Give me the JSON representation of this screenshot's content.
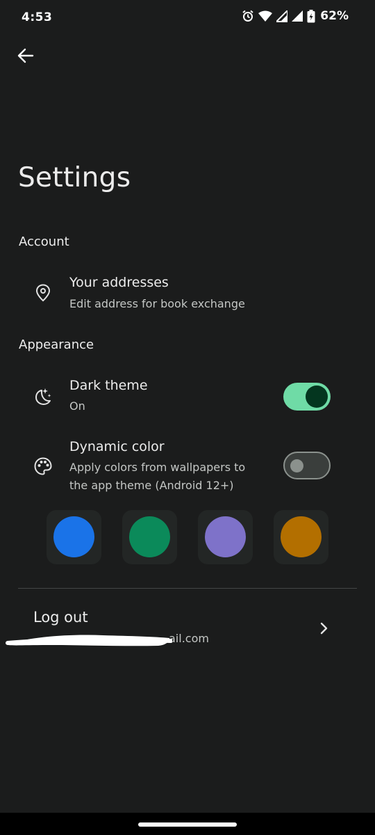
{
  "status_bar": {
    "time": "4:53",
    "battery": "62%",
    "icons": [
      "alarm-icon",
      "wifi-icon",
      "signal-icon",
      "signal-icon",
      "battery-charging-icon"
    ]
  },
  "header": {
    "back_icon": "arrow-back-icon",
    "title": "Settings"
  },
  "sections": {
    "account": {
      "header": "Account",
      "addresses": {
        "icon": "location-pin-icon",
        "title": "Your addresses",
        "subtitle": "Edit address for book exchange"
      }
    },
    "appearance": {
      "header": "Appearance",
      "dark_theme": {
        "icon": "moon-stars-icon",
        "title": "Dark theme",
        "subtitle": "On",
        "enabled": true
      },
      "dynamic_color": {
        "icon": "palette-icon",
        "title": "Dynamic color",
        "subtitle": "Apply colors from wallpapers to the app theme (Android 12+)",
        "enabled": false
      },
      "color_swatches": [
        "#1a73e8",
        "#0b8a5a",
        "#7e72c9",
        "#b36f00"
      ]
    }
  },
  "logout": {
    "title": "Log out",
    "email_visible_suffix": "ail.com",
    "chevron_icon": "chevron-right-icon"
  },
  "colors": {
    "background": "#1b1c1c",
    "toggle_on_track": "#6fdba6",
    "toggle_on_knob": "#04361f"
  }
}
